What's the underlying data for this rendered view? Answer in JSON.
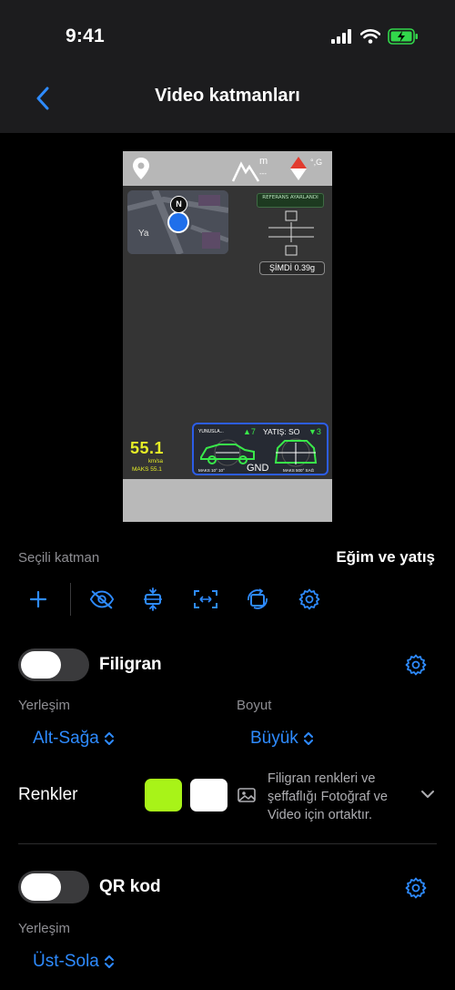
{
  "status": {
    "time": "9:41"
  },
  "nav": {
    "title": "Video katmanları"
  },
  "preview": {
    "ref_label": "REFERANS AYARLANDI",
    "now_label": "ŞİMDİ 0.39g",
    "speed_value": "55.1",
    "speed_unit": "km/sa",
    "speed_max": "MAKS 55.1",
    "map_label": "Ya",
    "compass": "N",
    "altitude_unit": "m",
    "altitude_value": "---",
    "heading_value": "°,G",
    "tilt": {
      "pitch_label": "YUNUSLA...",
      "pitch_value": "▲7",
      "roll_label": "YATIŞ: SO",
      "roll_value": "▼3",
      "center_label": "GND",
      "max_left": "MAKS 10° 10°",
      "max_right": "MAKS 500° SAĞ"
    }
  },
  "selected_layer": {
    "label": "Seçili katman",
    "value": "Eğim ve yatış"
  },
  "toolbar_icons": [
    "plus-icon",
    "eye-slash-icon",
    "align-center-icon",
    "resize-icon",
    "rotate-icon",
    "gear-icon"
  ],
  "watermark": {
    "title": "Filigran",
    "enabled": false,
    "placement_label": "Yerleşim",
    "placement_value": "Alt-Sağa",
    "size_label": "Boyut",
    "size_value": "Büyük",
    "colors_label": "Renkler",
    "color_1": "#a8f318",
    "color_2": "#ffffff",
    "colors_desc": "Filigran renkleri ve şeffaflığı Fotoğraf ve Video için ortaktır."
  },
  "qr": {
    "title": "QR kod",
    "enabled": false,
    "placement_label": "Yerleşim",
    "placement_value": "Üst-Sola"
  },
  "colors": {
    "accent": "#2e8bff",
    "background": "#000000",
    "bar": "#1c1c1e"
  }
}
